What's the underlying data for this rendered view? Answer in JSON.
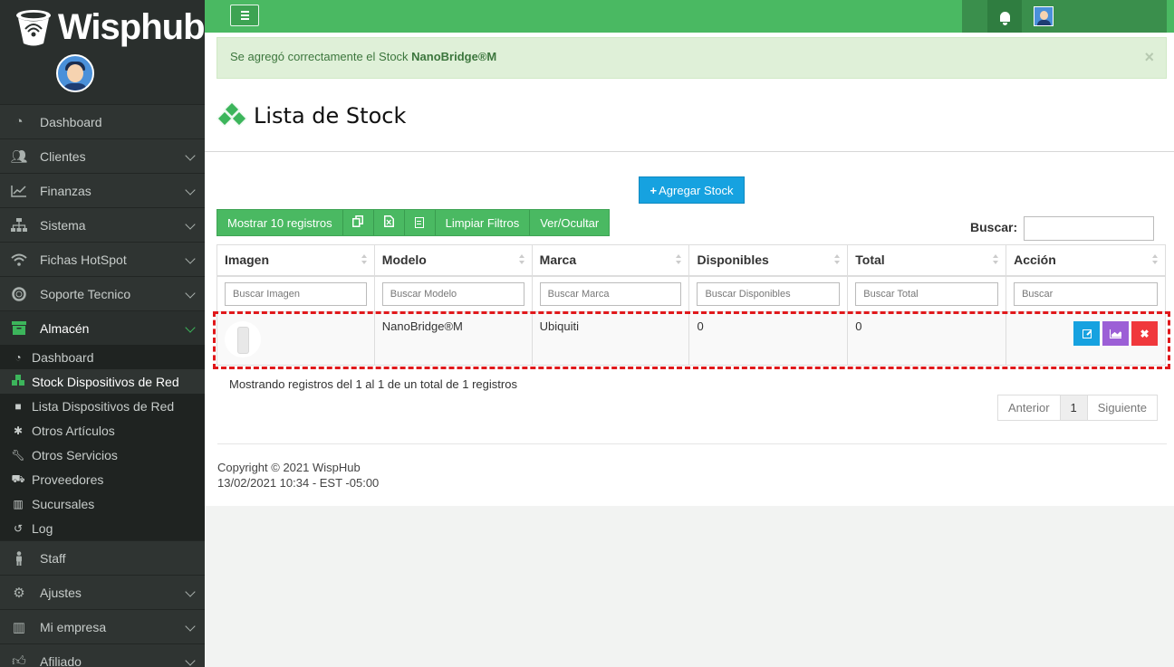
{
  "app": {
    "brand": "Wisphub"
  },
  "sidebar": {
    "items": [
      {
        "label": "Dashboard",
        "icon": "dashboard-icon"
      },
      {
        "label": "Clientes",
        "icon": "users-icon"
      },
      {
        "label": "Finanzas",
        "icon": "line-chart-icon"
      },
      {
        "label": "Sistema",
        "icon": "sitemap-icon"
      },
      {
        "label": "Fichas HotSpot",
        "icon": "wifi-icon"
      },
      {
        "label": "Soporte Tecnico",
        "icon": "lifebuoy-icon"
      },
      {
        "label": "Almacén",
        "icon": "archive-icon"
      }
    ],
    "sub_items": [
      {
        "label": "Dashboard",
        "icon": "dashboard-icon"
      },
      {
        "label": "Stock Dispositivos de Red",
        "icon": "cubes-icon"
      },
      {
        "label": "Lista Dispositivos de Red",
        "icon": "cube-icon"
      },
      {
        "label": "Otros Artículos",
        "icon": "asterisk-icon"
      },
      {
        "label": "Otros Servicios",
        "icon": "wrench-icon"
      },
      {
        "label": "Proveedores",
        "icon": "truck-icon"
      },
      {
        "label": "Sucursales",
        "icon": "building-icon"
      },
      {
        "label": "Log",
        "icon": "history-icon"
      }
    ],
    "bottom_items": [
      {
        "label": "Staff",
        "icon": "male-icon"
      },
      {
        "label": "Ajustes",
        "icon": "gear-icon"
      },
      {
        "label": "Mi empresa",
        "icon": "building-icon"
      },
      {
        "label": "Afiliado",
        "icon": "thumbs-up-icon"
      }
    ]
  },
  "alert": {
    "text": "Se agregó correctamente el Stock ",
    "bold": "NanoBridge®M",
    "close": "×"
  },
  "page": {
    "title": "Lista de Stock",
    "add_button": "Agregar Stock",
    "add_button_plus": "+"
  },
  "toolbar": {
    "show_records": "Mostrar 10 registros",
    "clear_filters": "Limpiar Filtros",
    "toggle_columns": "Ver/Ocultar",
    "search_label": "Buscar:"
  },
  "table": {
    "headers": [
      "Imagen",
      "Modelo",
      "Marca",
      "Disponibles",
      "Total",
      "Acción"
    ],
    "filters": [
      "Buscar Imagen",
      "Buscar Modelo",
      "Buscar Marca",
      "Buscar Disponibles",
      "Buscar Total",
      "Buscar"
    ],
    "rows": [
      {
        "modelo": "NanoBridge®M",
        "marca": "Ubiquiti",
        "disponibles": "0",
        "total": "0",
        "delete_glyph": "✖"
      }
    ]
  },
  "pagination": {
    "info": "Mostrando registros del 1 al 1 de un total de 1 registros",
    "prev": "Anterior",
    "current": "1",
    "next": "Siguiente"
  },
  "footer": {
    "copyright": "Copyright © 2021 WispHub",
    "timestamp": "13/02/2021 10:34 - EST -05:00"
  },
  "colors": {
    "accent": "#4ab962",
    "info": "#16a2e0",
    "danger": "#f0383c",
    "purple": "#9c5fd6",
    "highlight": "#e0181b"
  }
}
